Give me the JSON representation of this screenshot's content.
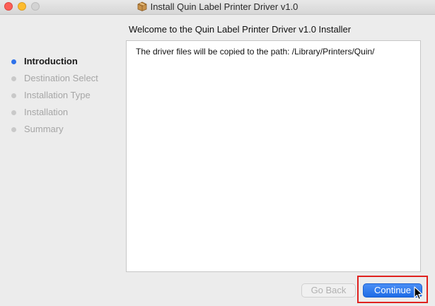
{
  "window": {
    "title": "Install Quin Label Printer Driver v1.0"
  },
  "main": {
    "heading": "Welcome to the Quin Label Printer Driver v1.0 Installer",
    "body_text": "The driver files will be copied to the path: /Library/Printers/Quin/"
  },
  "sidebar": {
    "steps": [
      {
        "label": "Introduction",
        "state": "current"
      },
      {
        "label": "Destination Select",
        "state": "pending"
      },
      {
        "label": "Installation Type",
        "state": "pending"
      },
      {
        "label": "Installation",
        "state": "pending"
      },
      {
        "label": "Summary",
        "state": "pending"
      }
    ]
  },
  "buttons": {
    "back_label": "Go Back",
    "back_enabled": false,
    "continue_label": "Continue"
  },
  "colors": {
    "accent": "#2f72ea",
    "highlight": "#e0221f"
  },
  "icons": {
    "title_icon": "package-icon",
    "cursor": "mouse-pointer-icon"
  }
}
